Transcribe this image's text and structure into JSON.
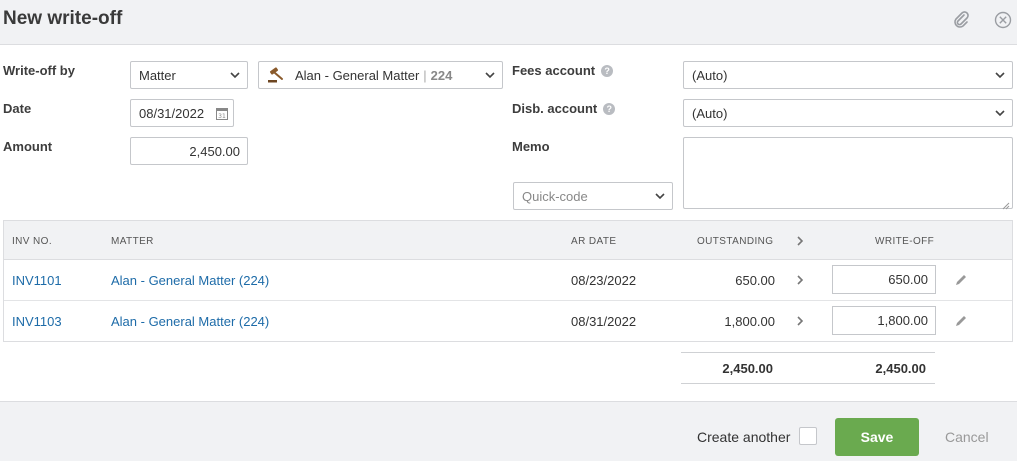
{
  "dialog": {
    "title": "New write-off"
  },
  "form": {
    "writeoff_by": {
      "label": "Write-off by",
      "value": "Matter"
    },
    "matter": {
      "name": "Alan - General Matter",
      "number": "224"
    },
    "date": {
      "label": "Date",
      "value": "08/31/2022"
    },
    "amount": {
      "label": "Amount",
      "value": "2,450.00"
    },
    "fees_account": {
      "label": "Fees account",
      "value": "(Auto)"
    },
    "disb_account": {
      "label": "Disb. account",
      "value": "(Auto)"
    },
    "memo": {
      "label": "Memo",
      "value": ""
    },
    "quick_code": {
      "placeholder": "Quick-code"
    }
  },
  "table": {
    "headers": {
      "inv_no": "INV NO.",
      "matter": "MATTER",
      "ar_date": "AR DATE",
      "outstanding": "OUTSTANDING",
      "writeoff": "WRITE-OFF"
    },
    "rows": [
      {
        "inv_no": "INV1101",
        "matter": "Alan - General Matter (224)",
        "ar_date": "08/23/2022",
        "outstanding": "650.00",
        "writeoff": "650.00"
      },
      {
        "inv_no": "INV1103",
        "matter": "Alan - General Matter (224)",
        "ar_date": "08/31/2022",
        "outstanding": "1,800.00",
        "writeoff": "1,800.00"
      }
    ],
    "totals": {
      "outstanding": "2,450.00",
      "writeoff": "2,450.00"
    }
  },
  "footer": {
    "create_another": "Create another",
    "save": "Save",
    "cancel": "Cancel"
  },
  "colors": {
    "link": "#1d6ba8",
    "save": "#6aaa4f"
  }
}
